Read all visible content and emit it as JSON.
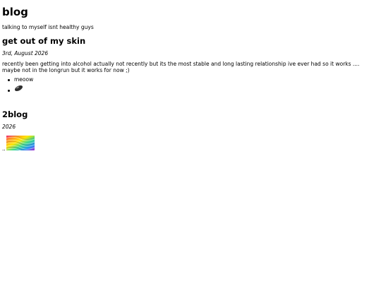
{
  "site": {
    "title": "blog",
    "tagline": "talking to myself isnt healthy guys"
  },
  "post1": {
    "title": "get out of my skin",
    "date": "3rd, August 2026",
    "body": "recently been getting into alcohol actually not recently but its the most stable and long lasting relationship ive ever had so it works .... maybe not in the longrun but it works for now ;)",
    "list": [
      {
        "text": "meoow"
      },
      {
        "icon": "pill-icon"
      }
    ]
  },
  "post2": {
    "title": "2blog",
    "date": "2026",
    "caption": "..",
    "image_icon": "rainbow-stripes-image"
  }
}
